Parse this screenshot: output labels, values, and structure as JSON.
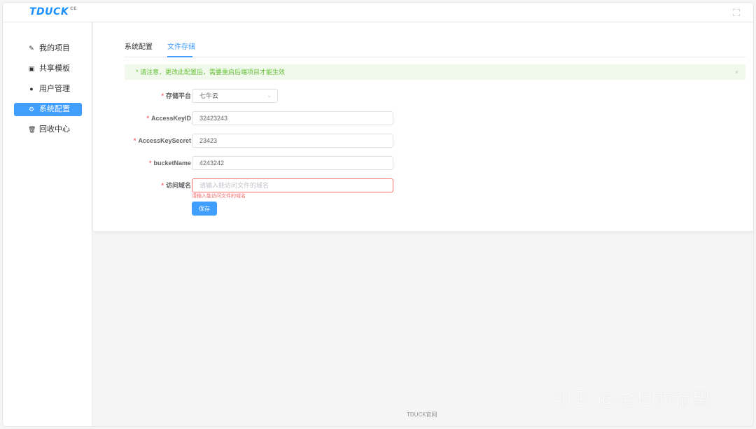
{
  "app": {
    "logo": "TDUCK",
    "logo_sup": "CE"
  },
  "sidebar": {
    "items": [
      {
        "label": "我的项目",
        "icon": "edit-icon",
        "glyph": "✎"
      },
      {
        "label": "共享模板",
        "icon": "template-icon",
        "glyph": "▣"
      },
      {
        "label": "用户管理",
        "icon": "user-icon",
        "glyph": "●"
      },
      {
        "label": "系统配置",
        "icon": "gear-icon",
        "glyph": "⚙"
      },
      {
        "label": "回收中心",
        "icon": "trash-icon",
        "glyph": "🗑"
      }
    ]
  },
  "tabs": [
    {
      "label": "系统配置"
    },
    {
      "label": "文件存储"
    }
  ],
  "alert": {
    "text": "* 请注意，更改此配置后，需要重启后端项目才能生效",
    "close": "×"
  },
  "form": {
    "platform": {
      "label": "存储平台",
      "value": "七牛云"
    },
    "access_key_id": {
      "label": "AccessKeyID",
      "value": "32423243"
    },
    "access_key_secret": {
      "label": "AccessKeySecret",
      "value": "23423"
    },
    "bucket_name": {
      "label": "bucketName",
      "value": "4243242"
    },
    "domain": {
      "label": "访问域名",
      "value": "",
      "placeholder": "请输入能访问文件的域名",
      "error": "请输入能访问文件的域名"
    },
    "required_mark": "*",
    "save_label": "保存"
  },
  "footer": {
    "text": "TDUCK官网"
  },
  "watermark": {
    "text": "知乎 @全村的希望"
  },
  "colors": {
    "primary": "#409eff",
    "success_bg": "#f0f9eb",
    "success_text": "#67c23a",
    "danger": "#f56c6c"
  }
}
